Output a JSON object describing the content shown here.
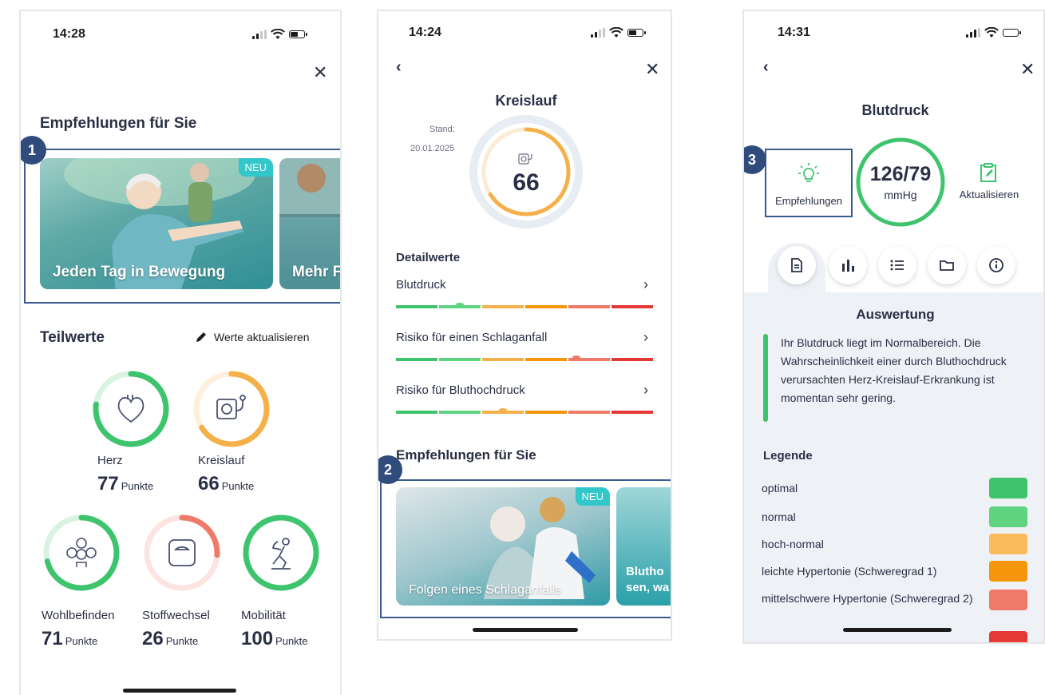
{
  "screen1": {
    "time": "14:28",
    "section_title": "Empfehlungen für Sie",
    "badge": "1",
    "cards": [
      {
        "label": "Jeden Tag in Bewegung",
        "tag": "NEU"
      },
      {
        "label": "Mehr F"
      }
    ],
    "teilwerte_title": "Teilwerte",
    "update_label": "Werte aktualisieren",
    "metrics": [
      {
        "name": "Herz",
        "value": "77",
        "unit": "Punkte",
        "score": 77,
        "color": "#3ec46d",
        "icon": "heart-icon"
      },
      {
        "name": "Kreislauf",
        "value": "66",
        "unit": "Punkte",
        "score": 66,
        "color": "#f5b04a",
        "icon": "blood-pressure-monitor-icon"
      },
      {
        "name": "Wohlbefinden",
        "value": "71",
        "unit": "Punkte",
        "score": 71,
        "color": "#3ec46d",
        "icon": "wellbeing-faces-icon"
      },
      {
        "name": "Stoffwechsel",
        "value": "26",
        "unit": "Punkte",
        "score": 26,
        "color": "#f07a6a",
        "icon": "scale-icon"
      },
      {
        "name": "Mobilität",
        "value": "100",
        "unit": "Punkte",
        "score": 100,
        "color": "#3ec46d",
        "icon": "running-person-icon"
      }
    ]
  },
  "screen2": {
    "time": "14:24",
    "title": "Kreislauf",
    "stand_label": "Stand:",
    "stand_date": "20.01.2025",
    "score": "66",
    "score_value": 66,
    "detail_title": "Detailwerte",
    "details": [
      {
        "label": "Blutdruck",
        "marker_segment": 1,
        "marker_pos": 0.5
      },
      {
        "label": "Risiko für einen Schlaganfall",
        "marker_segment": 4,
        "marker_pos": 0.2
      },
      {
        "label": "Risiko für Bluthochdruck",
        "marker_segment": 2,
        "marker_pos": 0.5
      }
    ],
    "scale_colors": [
      "#3ec46d",
      "#5fd37f",
      "#f5b04a",
      "#f5960a",
      "#f07a6a",
      "#e53935"
    ],
    "rec_title": "Empfehlungen für Sie",
    "badge": "2",
    "cards": [
      {
        "label": "Folgen eines Schlaganfalls",
        "tag": "NEU"
      },
      {
        "label": "Blutho sen, wa"
      }
    ]
  },
  "screen3": {
    "time": "14:31",
    "title": "Blutdruck",
    "badge": "3",
    "rec_button": "Empfehlungen",
    "value": "126/79",
    "unit": "mmHg",
    "update_button": "Aktualisieren",
    "tabs": [
      "document-icon",
      "bar-chart-icon",
      "list-icon",
      "folder-icon",
      "info-icon"
    ],
    "evaluation_title": "Auswertung",
    "evaluation_text": "Ihr Blutdruck liegt im Normalbereich. Die Wahrscheinlichkeit einer durch Bluthochdruck verursachten Herz-Kreislauf-Erkrankung ist momentan sehr gering.",
    "legend_title": "Legende",
    "legend": [
      {
        "label": "optimal",
        "color": "#3ec46d"
      },
      {
        "label": "normal",
        "color": "#5fd37f"
      },
      {
        "label": "hoch-normal",
        "color": "#f8bb5c"
      },
      {
        "label": "leichte Hypertonie (Schweregrad 1)",
        "color": "#f5960a"
      },
      {
        "label": "mittelschwere Hypertonie (Schweregrad 2)",
        "color": "#f07a6a"
      },
      {
        "color": "#e53935"
      }
    ]
  }
}
